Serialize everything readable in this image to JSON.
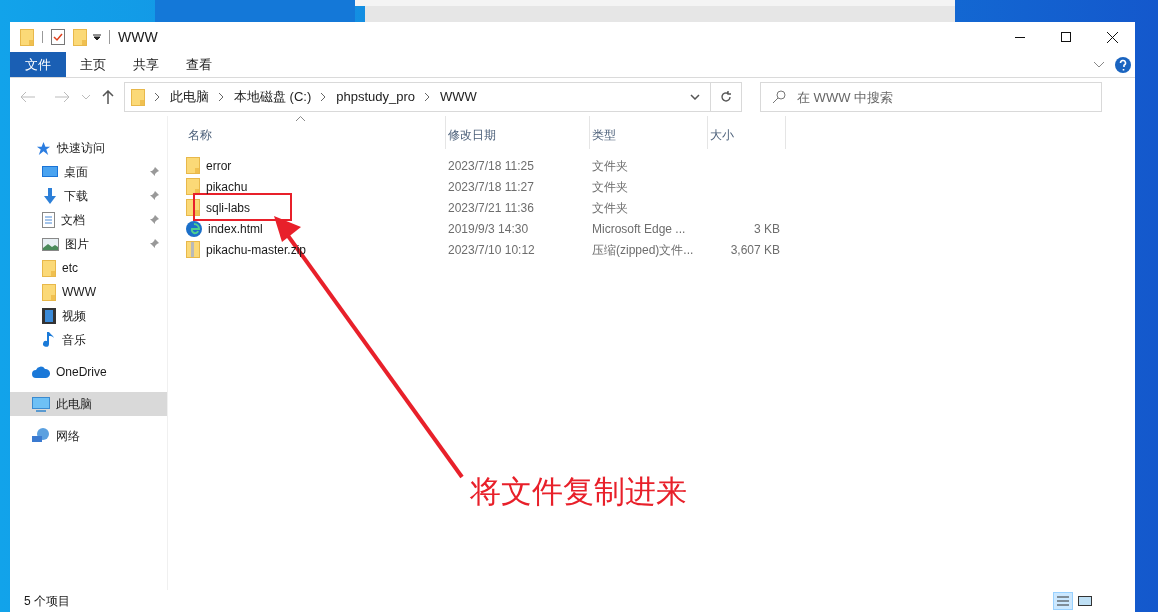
{
  "window": {
    "title": "WWW"
  },
  "ribbon_tabs": [
    {
      "label": "文件",
      "selected": true
    },
    {
      "label": "主页",
      "selected": false
    },
    {
      "label": "共享",
      "selected": false
    },
    {
      "label": "查看",
      "selected": false
    }
  ],
  "address": {
    "path": [
      "此电脑",
      "本地磁盘 (C:)",
      "phpstudy_pro",
      "WWW"
    ]
  },
  "search": {
    "placeholder": "在 WWW 中搜索"
  },
  "sidebar": {
    "items": [
      {
        "label": "快速访问",
        "kind": "quick",
        "pinned": false,
        "selected": false
      },
      {
        "label": "桌面",
        "kind": "desktop",
        "pinned": true,
        "selected": false
      },
      {
        "label": "下载",
        "kind": "download",
        "pinned": true,
        "selected": false
      },
      {
        "label": "文档",
        "kind": "document",
        "pinned": true,
        "selected": false
      },
      {
        "label": "图片",
        "kind": "picture",
        "pinned": true,
        "selected": false
      },
      {
        "label": "etc",
        "kind": "folder",
        "pinned": false,
        "selected": false
      },
      {
        "label": "WWW",
        "kind": "folder",
        "pinned": false,
        "selected": false
      },
      {
        "label": "视频",
        "kind": "video",
        "pinned": false,
        "selected": false
      },
      {
        "label": "音乐",
        "kind": "music",
        "pinned": false,
        "selected": false
      },
      {
        "label": "OneDrive",
        "kind": "cloud",
        "pinned": false,
        "selected": false
      },
      {
        "label": "此电脑",
        "kind": "pc",
        "pinned": false,
        "selected": true
      },
      {
        "label": "网络",
        "kind": "network",
        "pinned": false,
        "selected": false
      }
    ]
  },
  "table": {
    "columns": [
      "名称",
      "修改日期",
      "类型",
      "大小"
    ],
    "rows": [
      {
        "name": "error",
        "kind": "folder",
        "modified": "2023/7/18 11:25",
        "type": "文件夹"
      },
      {
        "name": "pikachu",
        "kind": "folder",
        "modified": "2023/7/18 11:27",
        "type": "文件夹"
      },
      {
        "name": "sqli-labs",
        "kind": "folder",
        "modified": "2023/7/21 11:36",
        "type": "文件夹"
      },
      {
        "name": "index.html",
        "kind": "html",
        "modified": "2019/9/3 14:30",
        "type": "Microsoft Edge ...",
        "size": "3 KB"
      },
      {
        "name": "pikachu-master.zip",
        "kind": "zip",
        "modified": "2023/7/10 10:12",
        "type": "压缩(zipped)文件...",
        "size": "3,607 KB"
      }
    ]
  },
  "status_bar": {
    "count": "5 个项目",
    "view_buttons": [
      {
        "kind": "details",
        "selected": true
      },
      {
        "kind": "icons",
        "selected": false
      }
    ]
  },
  "annotation": {
    "text": "将文件复制进来"
  }
}
